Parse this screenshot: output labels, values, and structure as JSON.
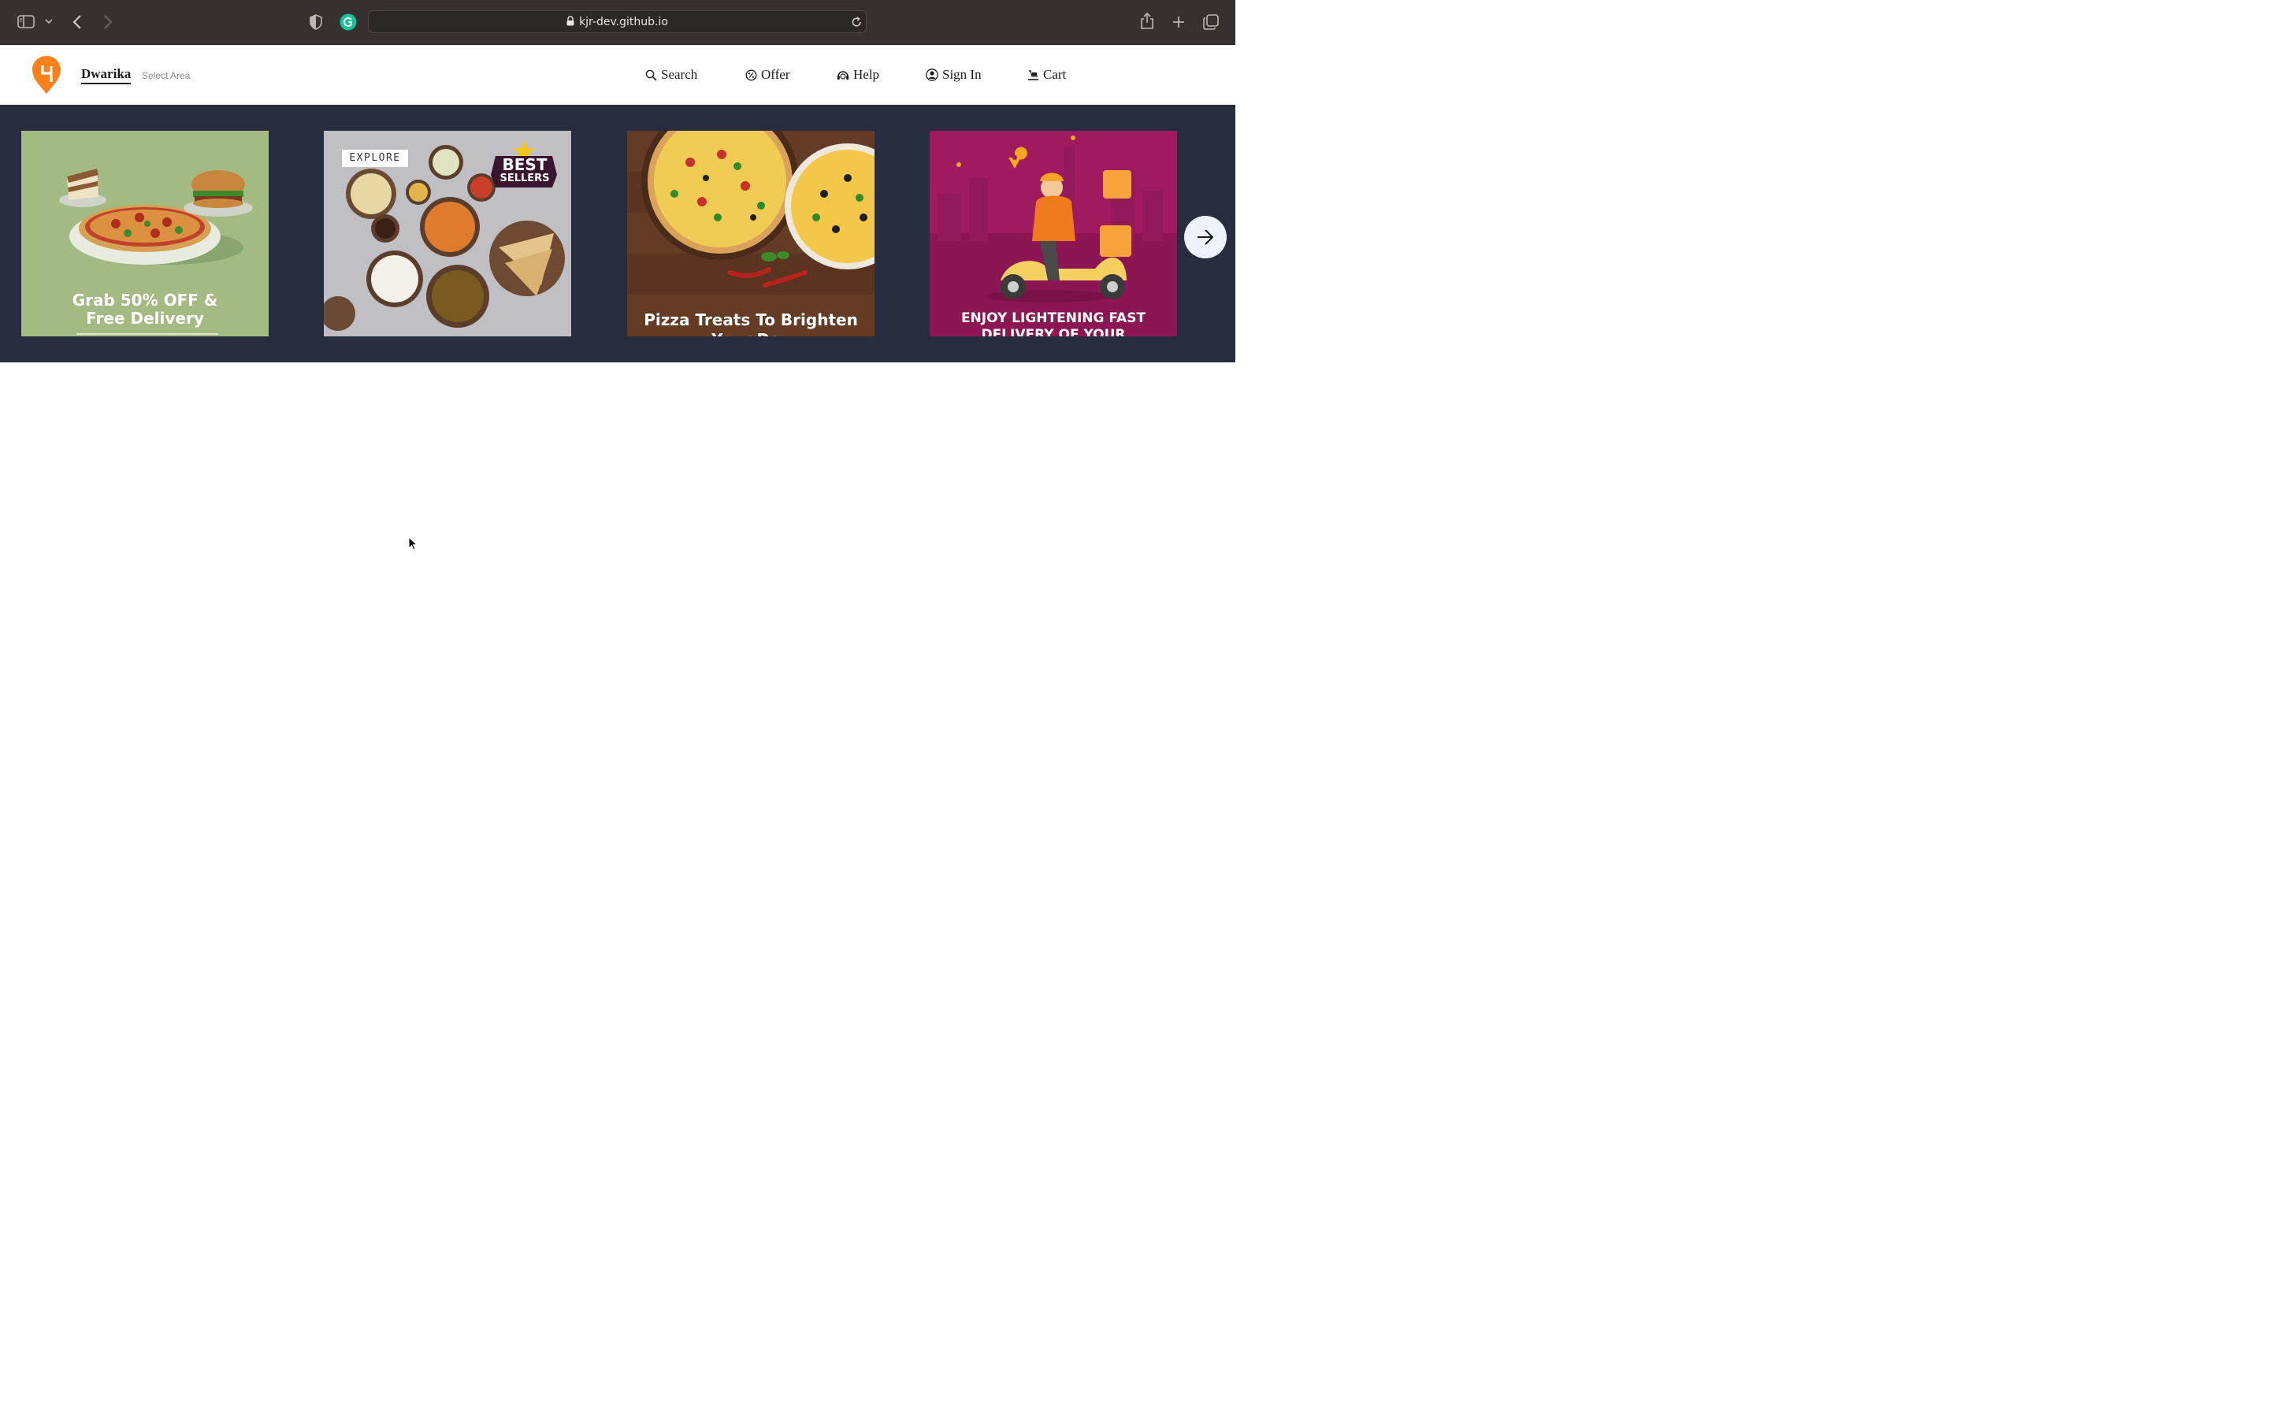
{
  "browser": {
    "url": "kjr-dev.github.io",
    "icons": [
      "sidebar-icon",
      "chevron-down-icon",
      "back-icon",
      "forward-icon",
      "privacy-shield-icon",
      "grammarly-icon",
      "lock-icon",
      "reload-icon",
      "share-icon",
      "new-tab-icon",
      "tabs-overview-icon"
    ]
  },
  "header": {
    "location": "Dwarika",
    "select_area": "Select Area",
    "nav": [
      {
        "label": "Search",
        "icon": "search-icon"
      },
      {
        "label": "Offer",
        "icon": "offer-icon"
      },
      {
        "label": "Help",
        "icon": "help-icon"
      },
      {
        "label": "Sign In",
        "icon": "user-icon"
      },
      {
        "label": "Cart",
        "icon": "cart-icon"
      }
    ],
    "brand_color": "#fc8019"
  },
  "carousel": {
    "background": "#282c3f",
    "cards": [
      {
        "caption_line1": "Grab 50% OFF &",
        "caption_line2": "Free Delivery"
      },
      {
        "tag": "EXPLORE",
        "badge_line1": "BEST",
        "badge_line2": "SELLERS"
      },
      {
        "caption_line1": "Pizza Treats To Brighten",
        "caption_line2": "Your Day"
      },
      {
        "caption_line1": "ENJOY LIGHTENING FAST",
        "caption_line2": "DELIVERY OF YOUR"
      }
    ],
    "next_icon": "arrow-right-icon"
  }
}
